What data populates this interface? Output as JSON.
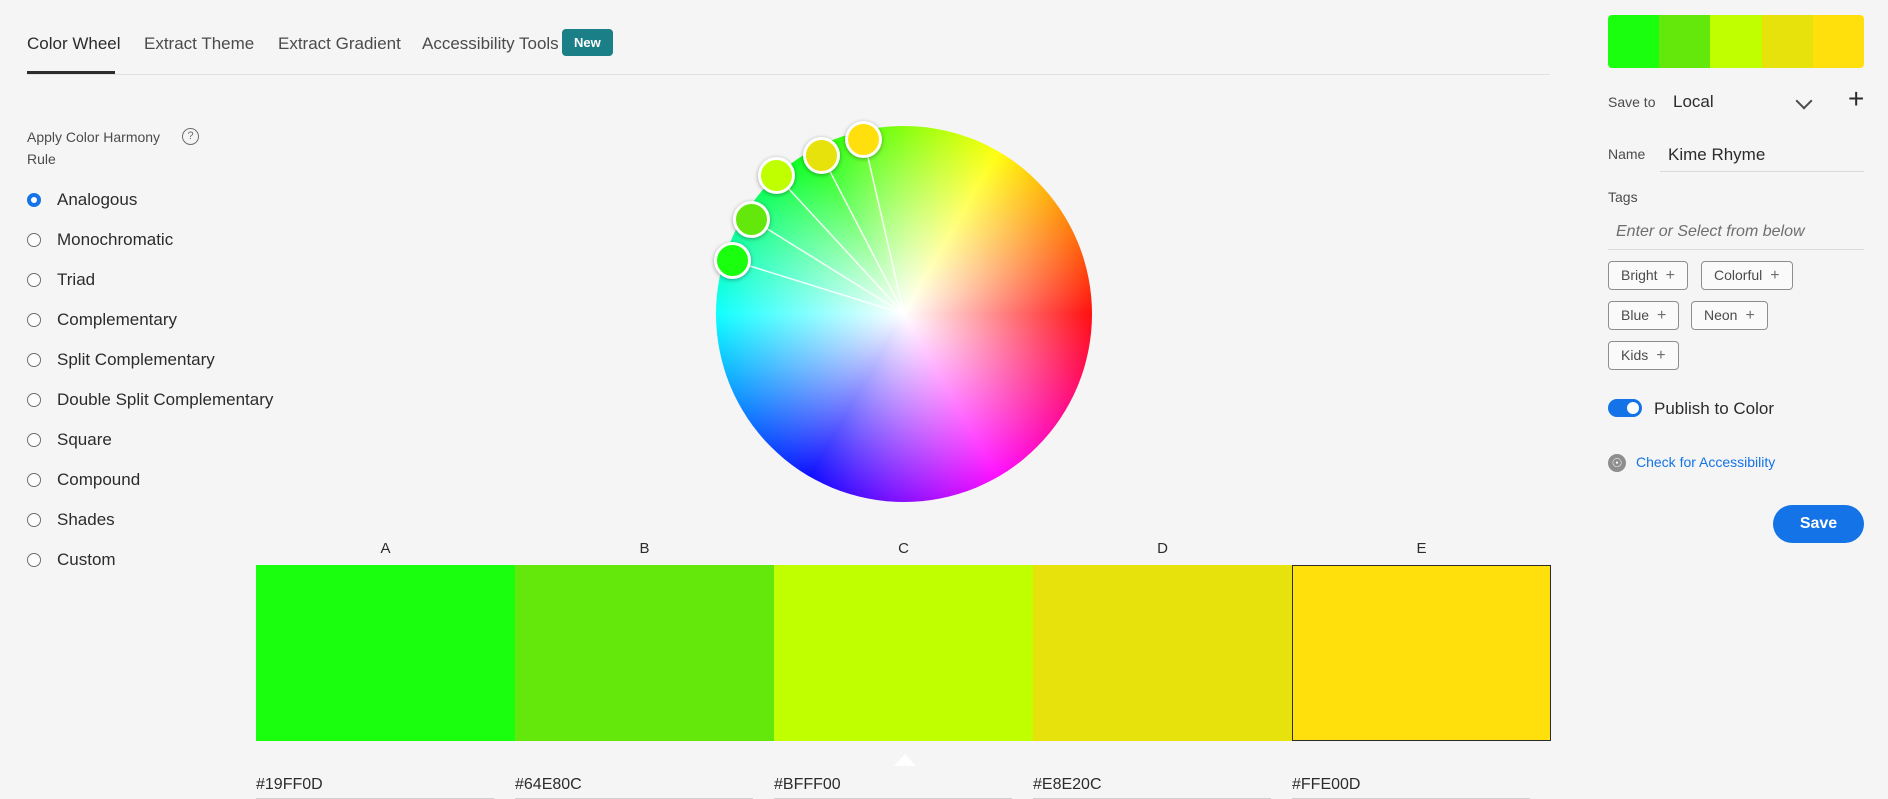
{
  "tabs": [
    {
      "label": "Color Wheel",
      "active": true
    },
    {
      "label": "Extract Theme",
      "active": false
    },
    {
      "label": "Extract Gradient",
      "active": false
    },
    {
      "label": "Accessibility Tools",
      "active": false
    }
  ],
  "new_badge": "New",
  "harmony": {
    "label": "Apply Color Harmony Rule",
    "help_icon": "?",
    "selected": "Analogous",
    "rules": [
      "Analogous",
      "Monochromatic",
      "Triad",
      "Complementary",
      "Split Complementary",
      "Double Split Complementary",
      "Square",
      "Compound",
      "Shades",
      "Custom"
    ]
  },
  "swatches": [
    {
      "letter": "A",
      "hex": "#19FF0D",
      "color": "#19ff0d"
    },
    {
      "letter": "B",
      "hex": "#64E80C",
      "color": "#64e80c"
    },
    {
      "letter": "C",
      "hex": "#BFFF00",
      "color": "#bfff00"
    },
    {
      "letter": "D",
      "hex": "#E8E20C",
      "color": "#e8e20c"
    },
    {
      "letter": "E",
      "hex": "#FFE00D",
      "color": "#ffe00d"
    }
  ],
  "selected_swatch": "E",
  "base_swatch": "C",
  "panel": {
    "save_to_label": "Save to",
    "save_to_value": "Local",
    "add_icon": "+",
    "name_label": "Name",
    "name_value": "Kime Rhyme",
    "tags_label": "Tags",
    "tags_placeholder": "Enter or Select from below",
    "tags": [
      "Bright",
      "Colorful",
      "Blue",
      "Neon",
      "Kids"
    ],
    "tag_plus": "+",
    "publish_label": "Publish to Color",
    "publish_on": true,
    "accessibility_link": "Check for Accessibility",
    "save_label": "Save"
  }
}
